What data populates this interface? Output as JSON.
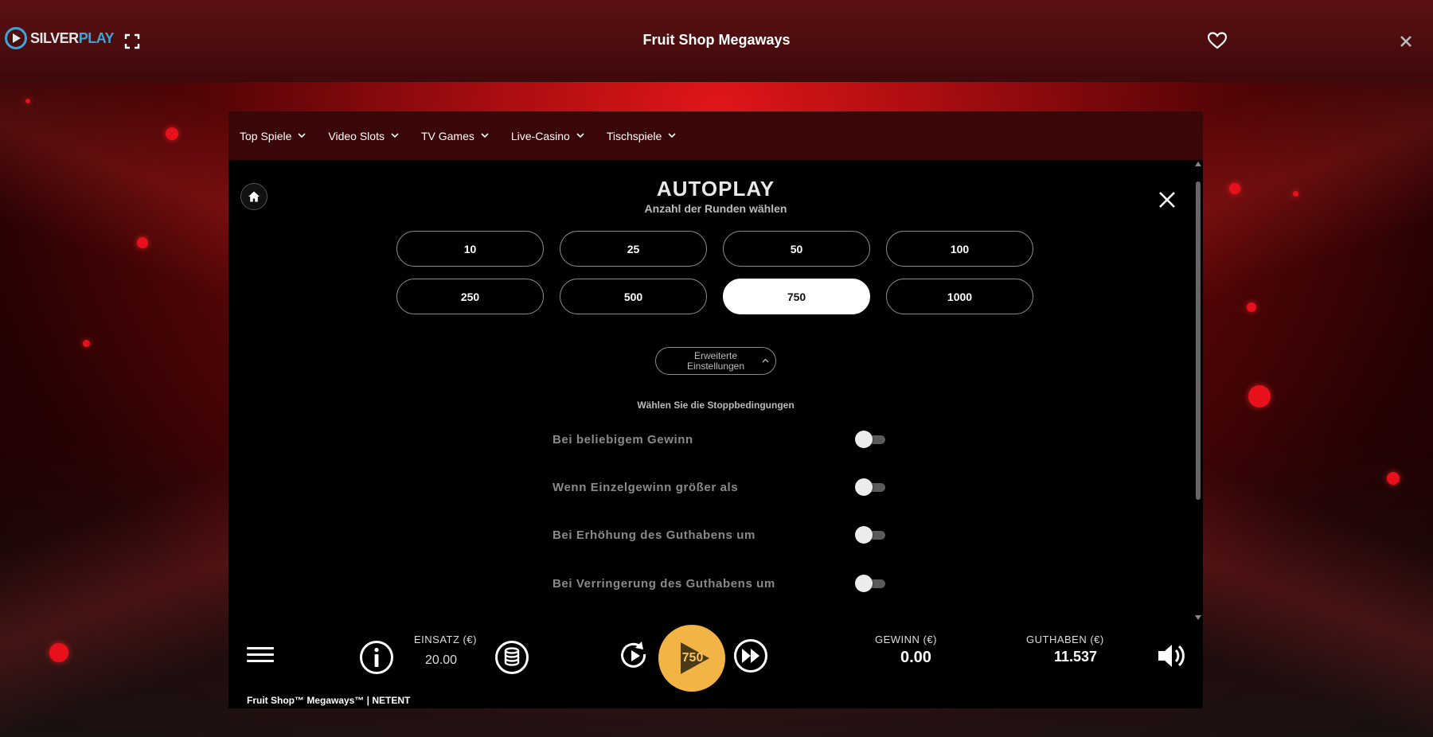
{
  "topbar": {
    "logo_silver": "SILVER",
    "logo_play": "PLAY",
    "title": "Fruit Shop Megaways"
  },
  "game_nav": {
    "items": [
      {
        "label": "Top Spiele"
      },
      {
        "label": "Video Slots"
      },
      {
        "label": "TV Games"
      },
      {
        "label": "Live-Casino"
      },
      {
        "label": "Tischspiele"
      }
    ]
  },
  "autoplay": {
    "title": "AUTOPLAY",
    "subtitle": "Anzahl der Runden wählen",
    "rounds": [
      "10",
      "25",
      "50",
      "100",
      "250",
      "500",
      "750",
      "1000"
    ],
    "selected_round": "750",
    "advanced_label_line1": "Erweiterte",
    "advanced_label_line2": "Einstellungen",
    "stop_heading": "Wählen Sie die Stoppbedingungen",
    "conditions": [
      {
        "label": "Bei beliebigem Gewinn",
        "on": false
      },
      {
        "label": "Wenn Einzelgewinn größer als",
        "on": false
      },
      {
        "label": "Bei Erhöhung des Guthabens um",
        "on": false
      },
      {
        "label": "Bei Verringerung des Guthabens um",
        "on": false
      }
    ]
  },
  "bottom_bar": {
    "bet_label": "EINSATZ (€)",
    "bet_value": "20.00",
    "spin_count": "750",
    "win_label": "GEWINN (€)",
    "win_value": "0.00",
    "balance_label": "GUTHABEN (€)",
    "balance_value": "11.537",
    "footer": "Fruit Shop™ Megaways™  |  NETENT"
  },
  "colors": {
    "play_button": "#f3b446",
    "brand_blue": "#3fa3d8",
    "nav_background": "#3a0708"
  }
}
